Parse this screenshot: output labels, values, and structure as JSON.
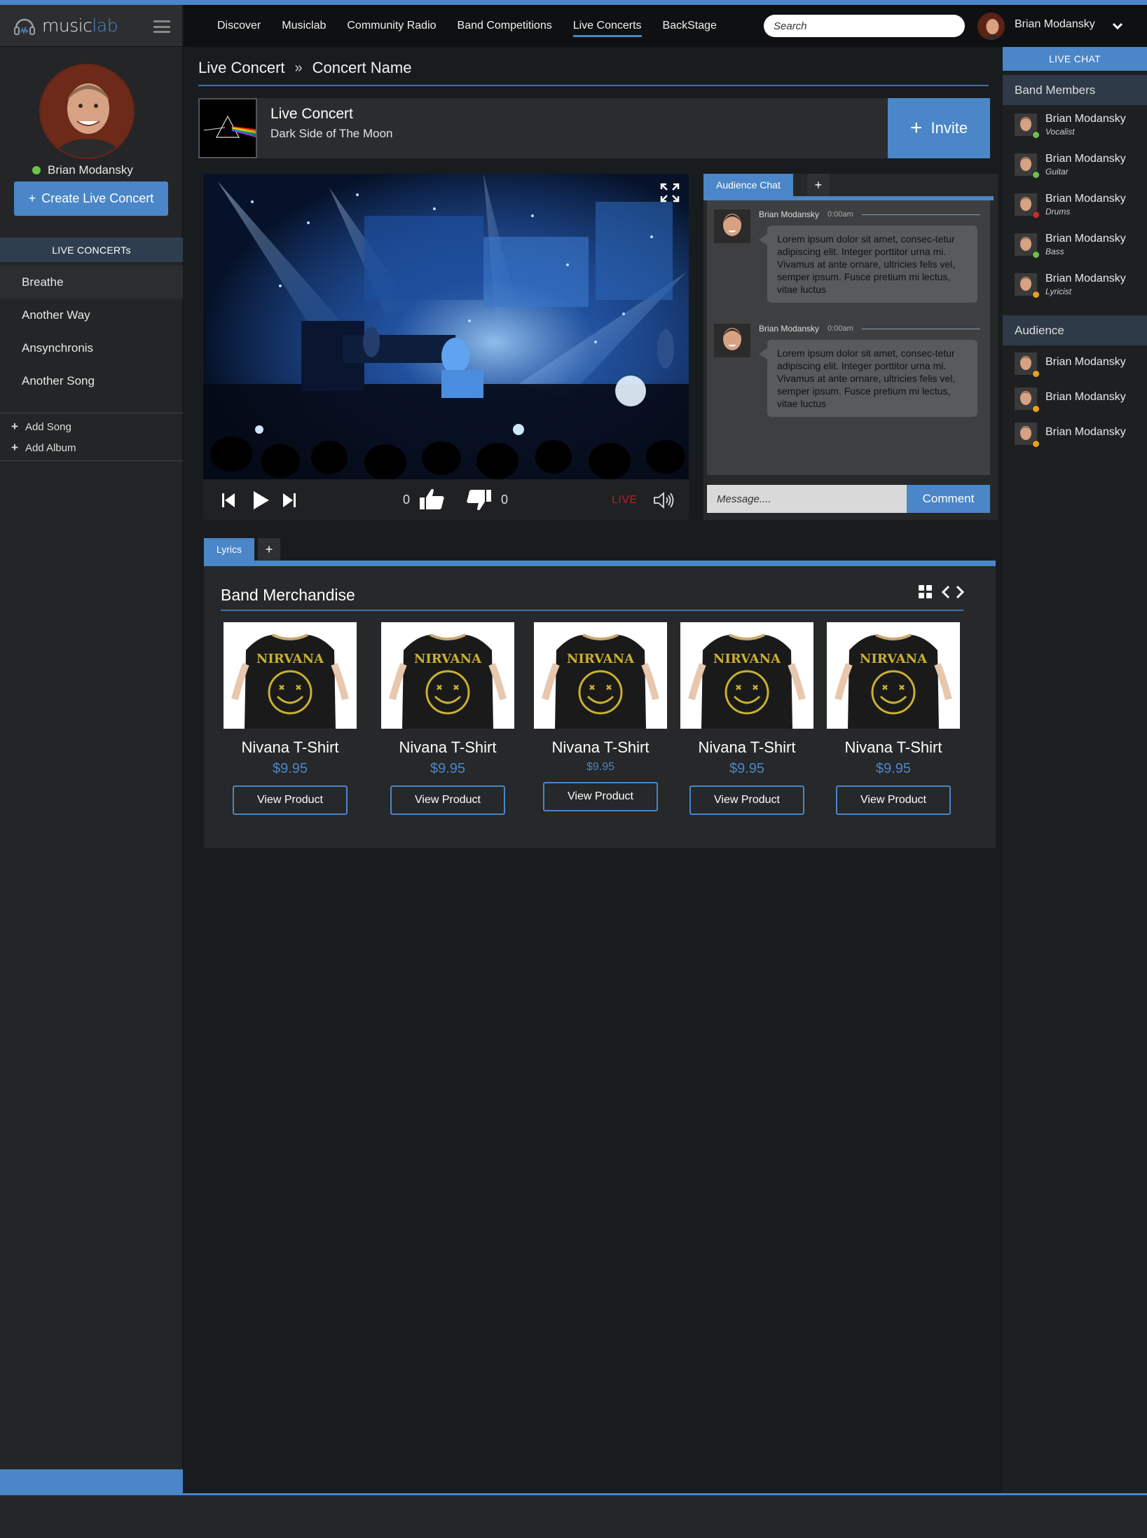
{
  "brand": {
    "name_part1": "music",
    "name_part2": "lab"
  },
  "nav": {
    "links": [
      "Discover",
      "Musiclab",
      "Community Radio",
      "Band Competitions",
      "Live Concerts",
      "BackStage"
    ],
    "active": "Live Concerts",
    "search_placeholder": "Search",
    "user_name": "Brian Modansky"
  },
  "sidebar": {
    "user_name": "Brian Modansky",
    "status": "online",
    "create_button": "Create Live Concert",
    "section_title": "LIVE CONCERTs",
    "songs": [
      "Breathe",
      "Another Way",
      "Ansynchronis",
      "Another Song"
    ],
    "active_song": "Breathe",
    "add_song": "Add  Song",
    "add_album": "Add  Album"
  },
  "breadcrumb": {
    "root": "Live Concert",
    "current": "Concert Name"
  },
  "concert": {
    "title": "Live Concert",
    "album": "Dark Side of The Moon",
    "invite_label": "Invite"
  },
  "player": {
    "likes": "0",
    "dislikes": "0",
    "live_label": "LIVE"
  },
  "audience_chat": {
    "tab_label": "Audience Chat",
    "add_tab": "+",
    "messages": [
      {
        "author": "Brian Modansky",
        "time": "0:00am",
        "text": "Lorem ipsum dolor sit amet, consec-tetur adipiscing elit. Integer porttitor urna mi. Vivamus at ante ornare, ultricies felis vel, semper ipsum. Fusce pretium mi lectus, vitae luctus"
      },
      {
        "author": "Brian Modansky",
        "time": "0:00am",
        "text": "Lorem ipsum dolor sit amet, consec-tetur adipiscing elit. Integer porttitor urna mi. Vivamus at ante ornare, ultricies felis vel, semper ipsum. Fusce pretium mi lectus, vitae luctus"
      }
    ],
    "input_placeholder": "Message....",
    "comment_label": "Comment"
  },
  "lyrics": {
    "tab_label": "Lyrics",
    "add_tab": "+"
  },
  "merch": {
    "title": "Band Merchandise",
    "products": [
      {
        "name": "Nivana T-Shirt",
        "price": "$9.95",
        "button": "View Product"
      },
      {
        "name": "Nivana T-Shirt",
        "price": "$9.95",
        "button": "View Product"
      },
      {
        "name": "Nivana T-Shirt",
        "price": "$9.95",
        "button": "View Product"
      },
      {
        "name": "Nivana T-Shirt",
        "price": "$9.95",
        "button": "View Product"
      },
      {
        "name": "Nivana T-Shirt",
        "price": "$9.95",
        "button": "View Product"
      }
    ],
    "shirt_print": "NIRVANA"
  },
  "live_chat": {
    "header": "LIVE CHAT",
    "band_section": "Band Members",
    "members": [
      {
        "name": "Brian Modansky",
        "role": "Vocalist",
        "status_color": "#6bc24b"
      },
      {
        "name": "Brian Modansky",
        "role": "Guitar",
        "status_color": "#6bc24b"
      },
      {
        "name": "Brian Modansky",
        "role": "Drums",
        "status_color": "#c0302a"
      },
      {
        "name": "Brian Modansky",
        "role": "Bass",
        "status_color": "#6bc24b"
      },
      {
        "name": "Brian Modansky",
        "role": "Lyricist",
        "status_color": "#e6a21e"
      }
    ],
    "audience_section": "Audience",
    "audience": [
      {
        "name": "Brian Modansky",
        "status_color": "#e6a21e"
      },
      {
        "name": "Brian Modansky",
        "status_color": "#e6a21e"
      },
      {
        "name": "Brian Modansky",
        "status_color": "#e6a21e"
      }
    ]
  },
  "colors": {
    "accent": "#4a86c8",
    "live": "#b32020",
    "online": "#6bc24b"
  }
}
